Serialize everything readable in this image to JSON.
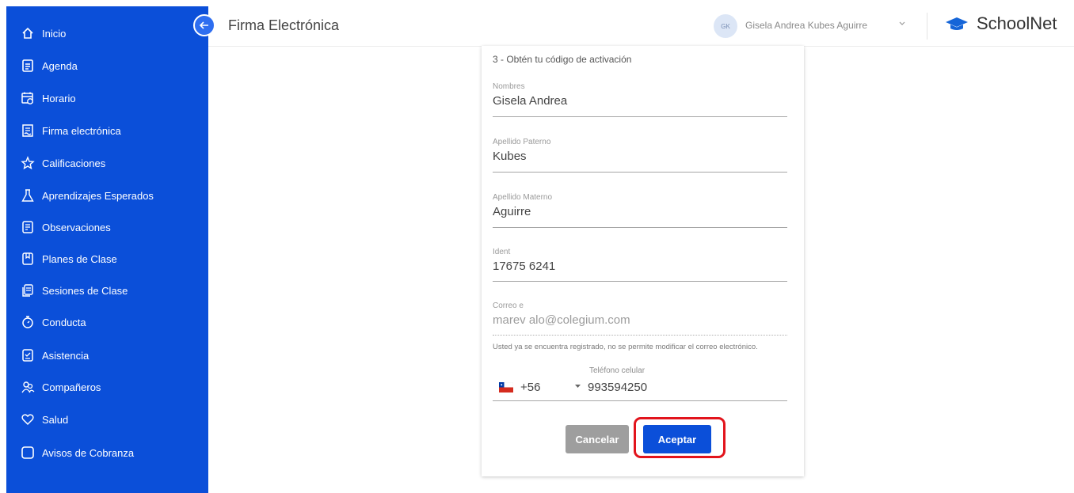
{
  "sidebar": {
    "items": [
      {
        "label": "Inicio",
        "icon": "home-icon"
      },
      {
        "label": "Agenda",
        "icon": "agenda-icon"
      },
      {
        "label": "Horario",
        "icon": "calendar-clock-icon"
      },
      {
        "label": "Firma electrónica",
        "icon": "signature-document-icon"
      },
      {
        "label": "Calificaciones",
        "icon": "star-icon"
      },
      {
        "label": "Aprendizajes Esperados",
        "icon": "flask-icon"
      },
      {
        "label": "Observaciones",
        "icon": "note-icon"
      },
      {
        "label": "Planes de Clase",
        "icon": "bookmark-icon"
      },
      {
        "label": "Sesiones de Clase",
        "icon": "copy-icon"
      },
      {
        "label": "Conducta",
        "icon": "stopwatch-icon"
      },
      {
        "label": "Asistencia",
        "icon": "checklist-icon"
      },
      {
        "label": "Compañeros",
        "icon": "people-icon"
      },
      {
        "label": "Salud",
        "icon": "heart-icon"
      },
      {
        "label": "Avisos de Cobranza",
        "icon": "square-icon"
      }
    ]
  },
  "header": {
    "title": "Firma Electrónica",
    "avatar_initials": "GK",
    "user_name": "Gisela Andrea Kubes Aguirre",
    "brand": "SchoolNet"
  },
  "form": {
    "subtitle": "3 - Obtén tu código de activación",
    "nombres": {
      "label": "Nombres",
      "value": "Gisela Andrea"
    },
    "paterno": {
      "label": "Apellido Paterno",
      "value": "Kubes"
    },
    "materno": {
      "label": "Apellido Materno",
      "value": "Aguirre"
    },
    "ident": {
      "label": "Ident",
      "value": "17675 6241"
    },
    "correo": {
      "label": "Correo e",
      "value": "marev alo@colegium.com"
    },
    "helper": "Usted ya se encuentra registrado, no se permite modificar el correo electrónico.",
    "telefono": {
      "label": "Teléfono celular",
      "country_code": "+56",
      "number": "993594250"
    },
    "cancel_label": "Cancelar",
    "accept_label": "Aceptar"
  },
  "colors": {
    "primary": "#0b4fd9",
    "highlight": "#e2141c",
    "cancel": "#9e9e9e"
  }
}
